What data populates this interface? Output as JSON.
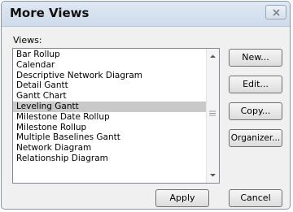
{
  "dialog": {
    "title": "More Views"
  },
  "views_label": "Views:",
  "views": [
    "Bar Rollup",
    "Calendar",
    "Descriptive Network Diagram",
    "Detail Gantt",
    "Gantt Chart",
    "Leveling Gantt",
    "Milestone Date Rollup",
    "Milestone Rollup",
    "Multiple Baselines Gantt",
    "Network Diagram",
    "Relationship Diagram"
  ],
  "selected_view": "Leveling Gantt",
  "buttons": {
    "new": "New...",
    "edit": "Edit...",
    "copy": "Copy...",
    "organizer": "Organizer...",
    "apply": "Apply",
    "cancel": "Cancel"
  },
  "icons": {
    "close": "close-icon",
    "scroll_up": "chevron-up-icon",
    "scroll_down": "chevron-down-icon"
  }
}
